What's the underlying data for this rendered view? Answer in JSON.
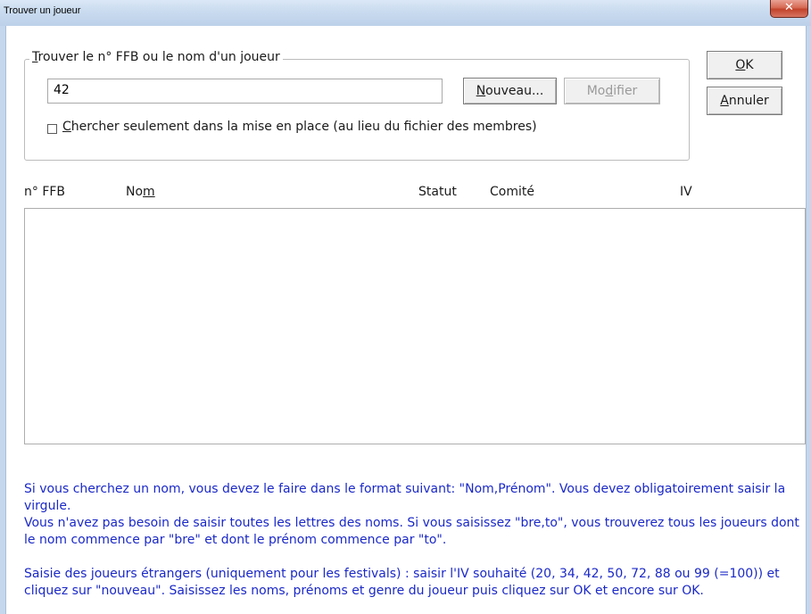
{
  "window": {
    "title": "Trouver un joueur",
    "close_glyph": "✕"
  },
  "search_group": {
    "label_prefix": "T",
    "label_rest": "rouver le n° FFB ou le nom d'un joueur",
    "input_value": "42",
    "nouveau_prefix": "N",
    "nouveau_rest": "ouveau...",
    "modifier_pre": "Mo",
    "modifier_acc": "d",
    "modifier_post": "ifier",
    "checkbox_prefix": "C",
    "checkbox_rest": "hercher seulement dans la mise en place (au lieu du fichier des membres)",
    "checkbox_checked": false
  },
  "buttons": {
    "ok_acc": "O",
    "ok_rest": "K",
    "annuler_acc": "A",
    "annuler_rest": "nnuler"
  },
  "list": {
    "columns": {
      "ffb": "n° FFB",
      "nom_pre": "No",
      "nom_acc": "m",
      "statut": "Statut",
      "comite": "Comité",
      "iv": "IV"
    },
    "rows": []
  },
  "help": {
    "p1": "Si vous cherchez un nom, vous devez le faire dans le format suivant: \"Nom,Prénom\". Vous devez obligatoirement saisir la virgule.",
    "p2": "Vous n'avez pas besoin de saisir toutes les lettres des noms. Si vous saisissez \"bre,to\", vous trouverez tous les joueurs dont le nom commence par \"bre\" et dont le prénom commence par \"to\".",
    "p3": "Saisie des joueurs étrangers (uniquement pour les festivals) : saisir l'IV souhaité (20, 34, 42, 50, 72, 88 ou 99 (=100)) et cliquez sur \"nouveau\". Saisissez les noms, prénoms et genre du joueur puis cliquez sur OK et encore sur OK."
  },
  "colors": {
    "help_text": "#1b29c7",
    "titlebar": "#c9dbef",
    "close_button": "#c2432b"
  }
}
